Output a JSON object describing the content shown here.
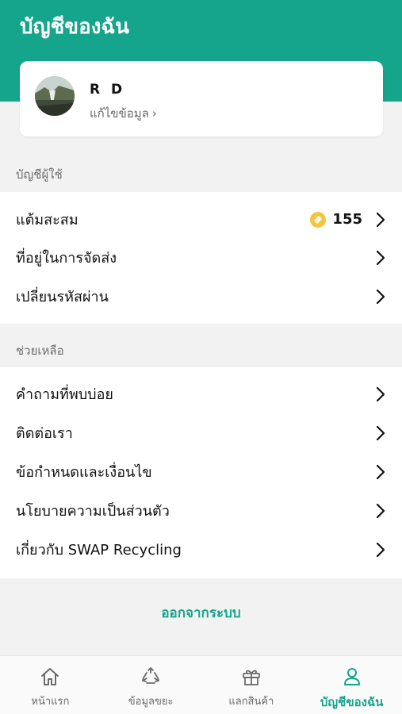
{
  "header": {
    "title": "บัญชีของฉัน"
  },
  "profile": {
    "name": "R D",
    "edit_label": "แก้ไขข้อมูล",
    "edit_chevron": "›"
  },
  "sections": {
    "account": {
      "label": "บัญชีผู้ใช้",
      "items": [
        {
          "label": "แต้มสะสม",
          "value": "155"
        },
        {
          "label": "ที่อยู่ในการจัดส่ง"
        },
        {
          "label": "เปลี่ยนรหัสผ่าน"
        }
      ]
    },
    "help": {
      "label": "ช่วยเหลือ",
      "items": [
        {
          "label": "คำถามที่พบบ่อย"
        },
        {
          "label": "ติดต่อเรา"
        },
        {
          "label": "ข้อกำหนดและเงื่อนไข"
        },
        {
          "label": "นโยบายความเป็นส่วนตัว"
        },
        {
          "label": "เกี่ยวกับ SWAP Recycling"
        }
      ]
    }
  },
  "logout_label": "ออกจากระบบ",
  "tabs": [
    {
      "label": "หน้าแรก",
      "icon": "home-icon"
    },
    {
      "label": "ข้อมูลขยะ",
      "icon": "recycle-icon"
    },
    {
      "label": "แลกสินค้า",
      "icon": "gift-icon"
    },
    {
      "label": "บัญชีของฉัน",
      "icon": "user-icon",
      "active": true
    }
  ],
  "colors": {
    "brand": "#14a58c",
    "coin": "#f4c542",
    "background": "#f2f2f2"
  }
}
